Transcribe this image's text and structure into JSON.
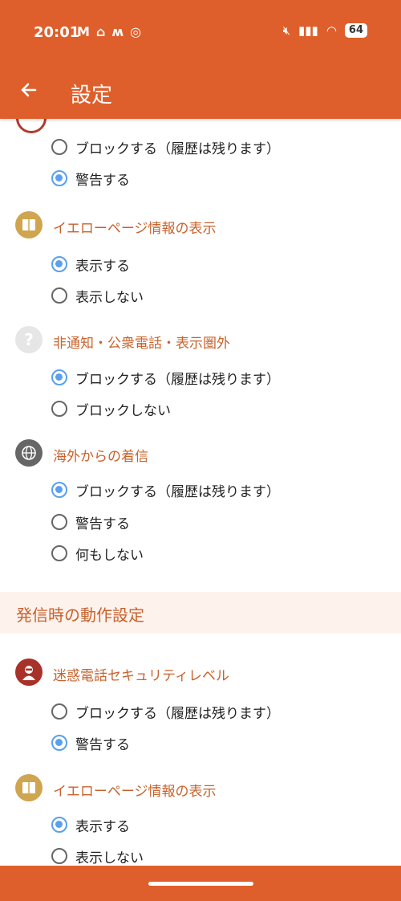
{
  "status_bar": {
    "time": "20:01",
    "battery": "64"
  },
  "app_bar": {
    "title": "設定"
  },
  "groups_top": [
    {
      "options": [
        {
          "label": "ブロックする（履歴は残ります）",
          "selected": false
        },
        {
          "label": "警告する",
          "selected": true
        }
      ]
    },
    {
      "heading": "イエローページ情報の表示",
      "icon": "yellow-page-book-icon",
      "options": [
        {
          "label": "表示する",
          "selected": true
        },
        {
          "label": "表示しない",
          "selected": false
        }
      ]
    },
    {
      "heading": "非通知・公衆電話・表示圏外",
      "icon": "unknown-caller-icon",
      "options": [
        {
          "label": "ブロックする（履歴は残ります）",
          "selected": true
        },
        {
          "label": "ブロックしない",
          "selected": false
        }
      ]
    },
    {
      "heading": "海外からの着信",
      "icon": "globe-phone-icon",
      "options": [
        {
          "label": "ブロックする（履歴は残ります）",
          "selected": true
        },
        {
          "label": "警告する",
          "selected": false
        },
        {
          "label": "何もしない",
          "selected": false
        }
      ]
    }
  ],
  "section": {
    "label": "発信時の動作設定"
  },
  "groups_bottom": [
    {
      "heading": "迷惑電話セキュリティレベル",
      "icon": "nuisance-caller-icon",
      "options": [
        {
          "label": "ブロックする（履歴は残ります）",
          "selected": false
        },
        {
          "label": "警告する",
          "selected": true
        }
      ]
    },
    {
      "heading": "イエローページ情報の表示",
      "icon": "yellow-page-book-icon",
      "options": [
        {
          "label": "表示する",
          "selected": true
        },
        {
          "label": "表示しない",
          "selected": false
        }
      ]
    }
  ],
  "colors": {
    "accent": "#de5f2b",
    "heading": "#c8622c",
    "radio_on": "#5a9ff0"
  }
}
